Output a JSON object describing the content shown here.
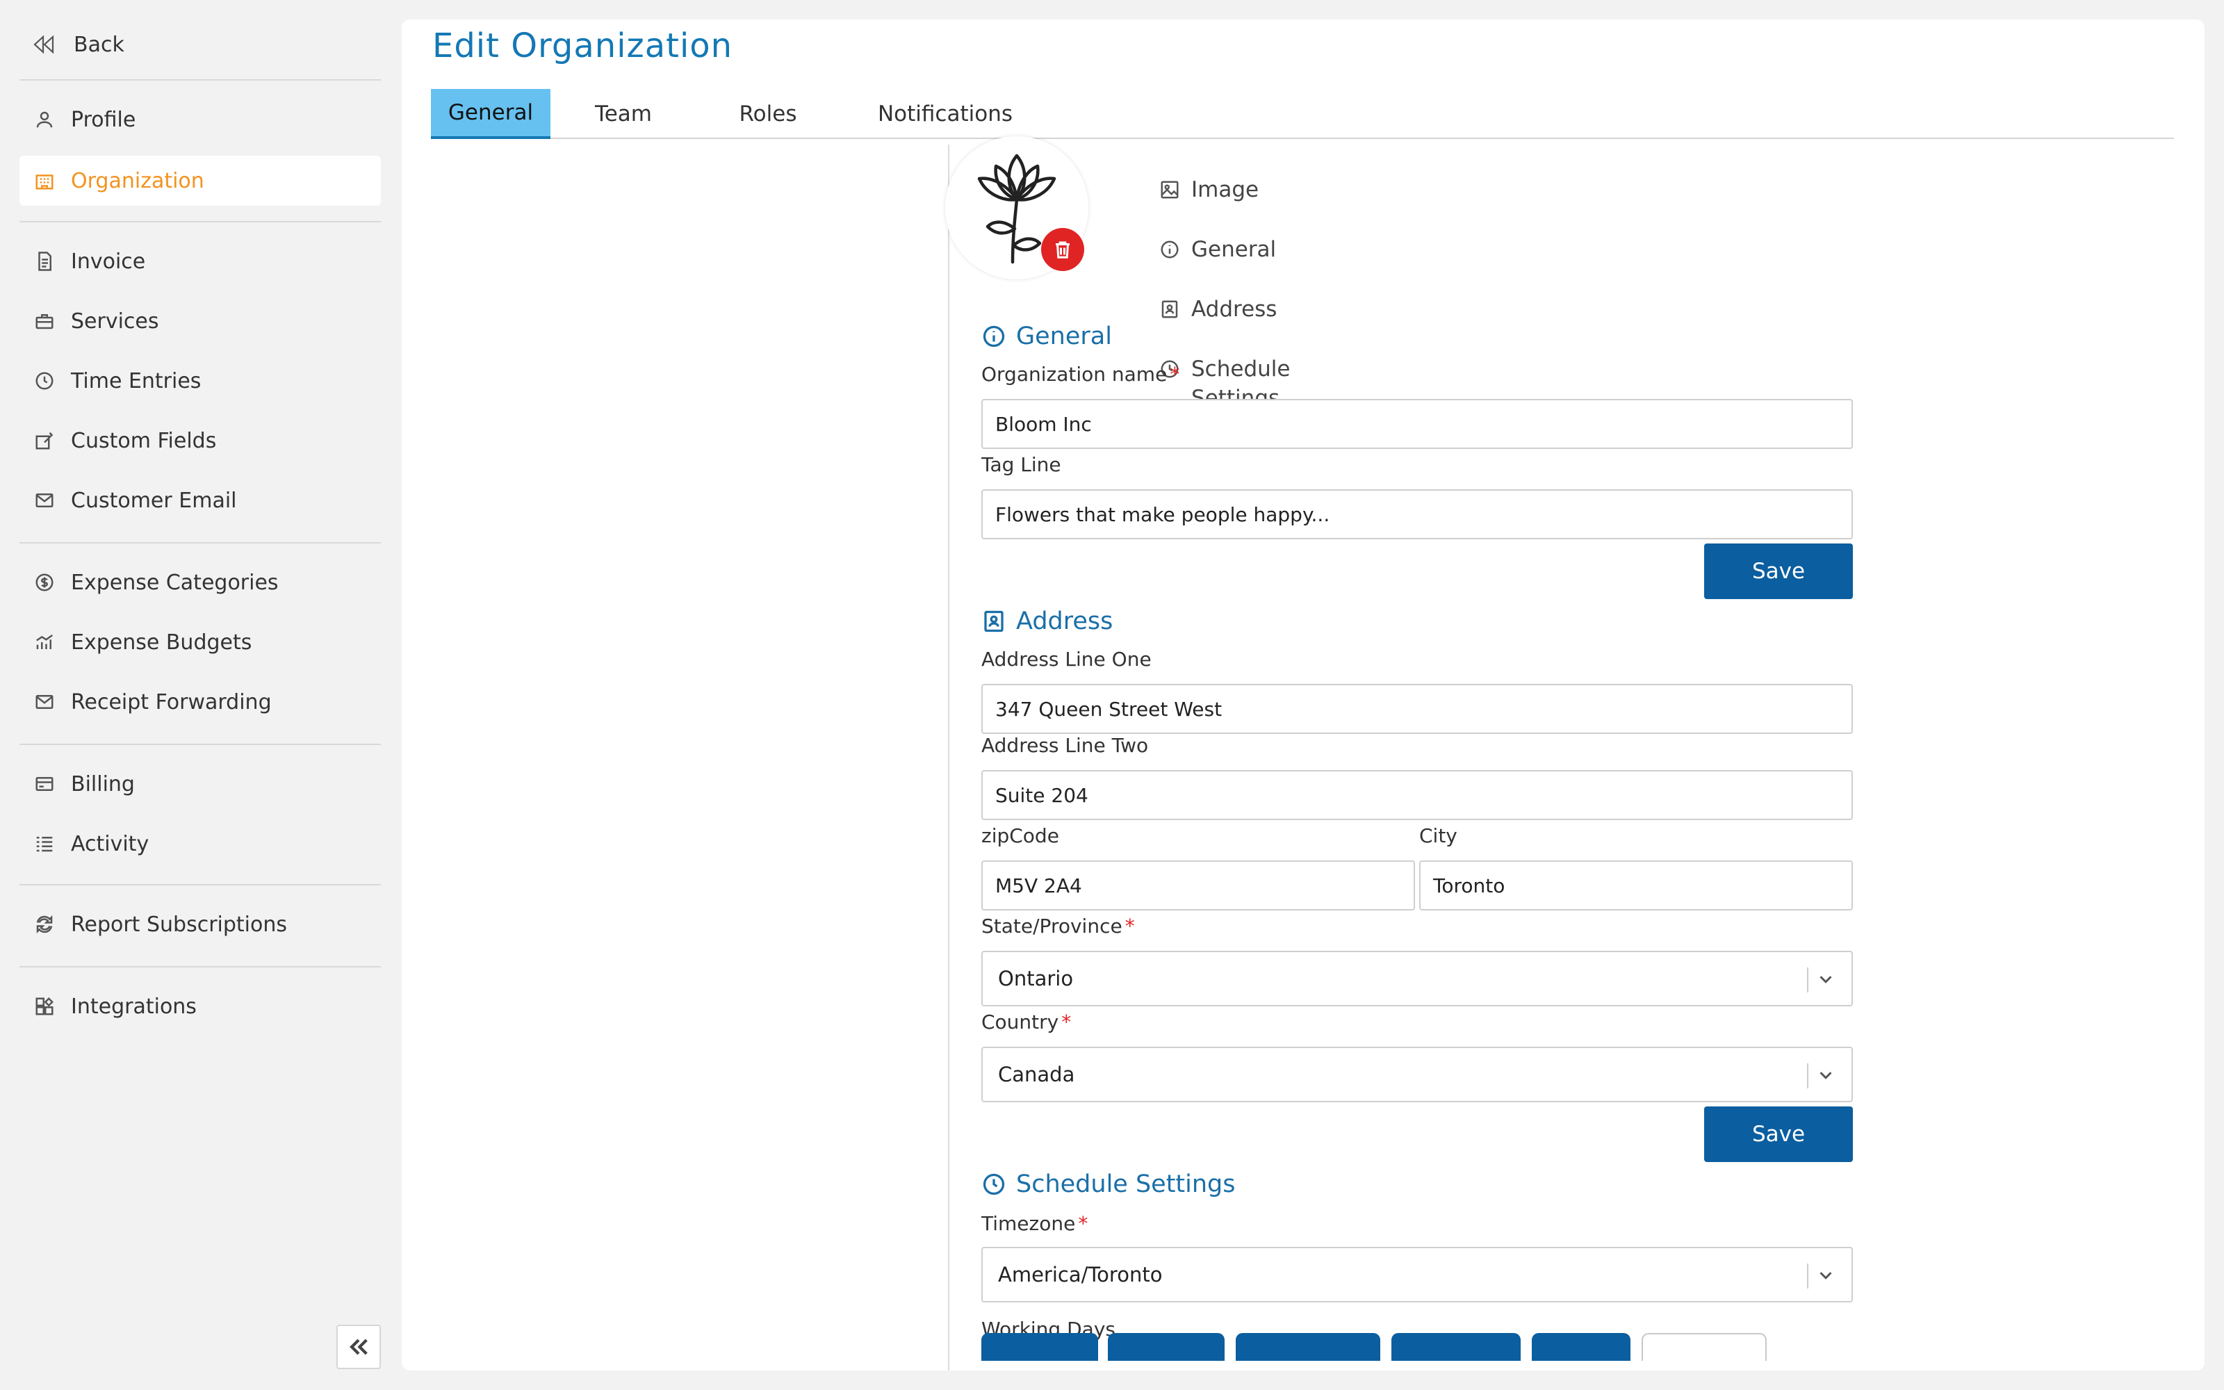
{
  "sidebar": {
    "back_label": "Back",
    "groups": [
      [
        {
          "label": "Profile",
          "icon": "user-icon"
        },
        {
          "label": "Organization",
          "icon": "building-icon",
          "active": true
        }
      ],
      [
        {
          "label": "Invoice",
          "icon": "invoice-icon"
        },
        {
          "label": "Services",
          "icon": "briefcase-icon"
        },
        {
          "label": "Time Entries",
          "icon": "clock-icon"
        },
        {
          "label": "Custom Fields",
          "icon": "edit-field-icon"
        },
        {
          "label": "Customer Email",
          "icon": "mail-icon"
        }
      ],
      [
        {
          "label": "Expense Categories",
          "icon": "dollar-circle-icon"
        },
        {
          "label": "Expense Budgets",
          "icon": "chart-icon"
        },
        {
          "label": "Receipt Forwarding",
          "icon": "mail-icon"
        }
      ],
      [
        {
          "label": "Billing",
          "icon": "card-icon"
        },
        {
          "label": "Activity",
          "icon": "list-icon"
        }
      ],
      [
        {
          "label": "Report Subscriptions",
          "icon": "refresh-icon"
        }
      ],
      [
        {
          "label": "Integrations",
          "icon": "puzzle-icon"
        }
      ]
    ]
  },
  "page": {
    "title": "Edit Organization",
    "tabs": [
      "General",
      "Team",
      "Roles",
      "Notifications"
    ],
    "active_tab": "General"
  },
  "section_nav": [
    {
      "label": "Image",
      "icon": "image-icon"
    },
    {
      "label": "General",
      "icon": "info-icon"
    },
    {
      "label": "Address",
      "icon": "contact-book-icon"
    },
    {
      "label": "Schedule Settings",
      "icon": "clock-icon"
    }
  ],
  "general": {
    "title": "General",
    "org_name_label": "Organization name",
    "org_name_value": "Bloom Inc",
    "tagline_label": "Tag Line",
    "tagline_value": "Flowers that make people happy...",
    "save_label": "Save"
  },
  "address": {
    "title": "Address",
    "line1_label": "Address Line One",
    "line1_value": "347 Queen Street West",
    "line2_label": "Address Line Two",
    "line2_value": "Suite 204",
    "zip_label": "zipCode",
    "zip_value": "M5V 2A4",
    "city_label": "City",
    "city_value": "Toronto",
    "state_label": "State/Province",
    "state_value": "Ontario",
    "country_label": "Country",
    "country_value": "Canada",
    "save_label": "Save"
  },
  "schedule": {
    "title": "Schedule Settings",
    "timezone_label": "Timezone",
    "timezone_value": "America/Toronto",
    "working_days_label": "Working Days"
  },
  "colors": {
    "accent": "#1478b4",
    "active_nav": "#f39320",
    "button": "#0b5e9f",
    "danger": "#e02424",
    "tab_active_bg": "#66c1f0"
  }
}
